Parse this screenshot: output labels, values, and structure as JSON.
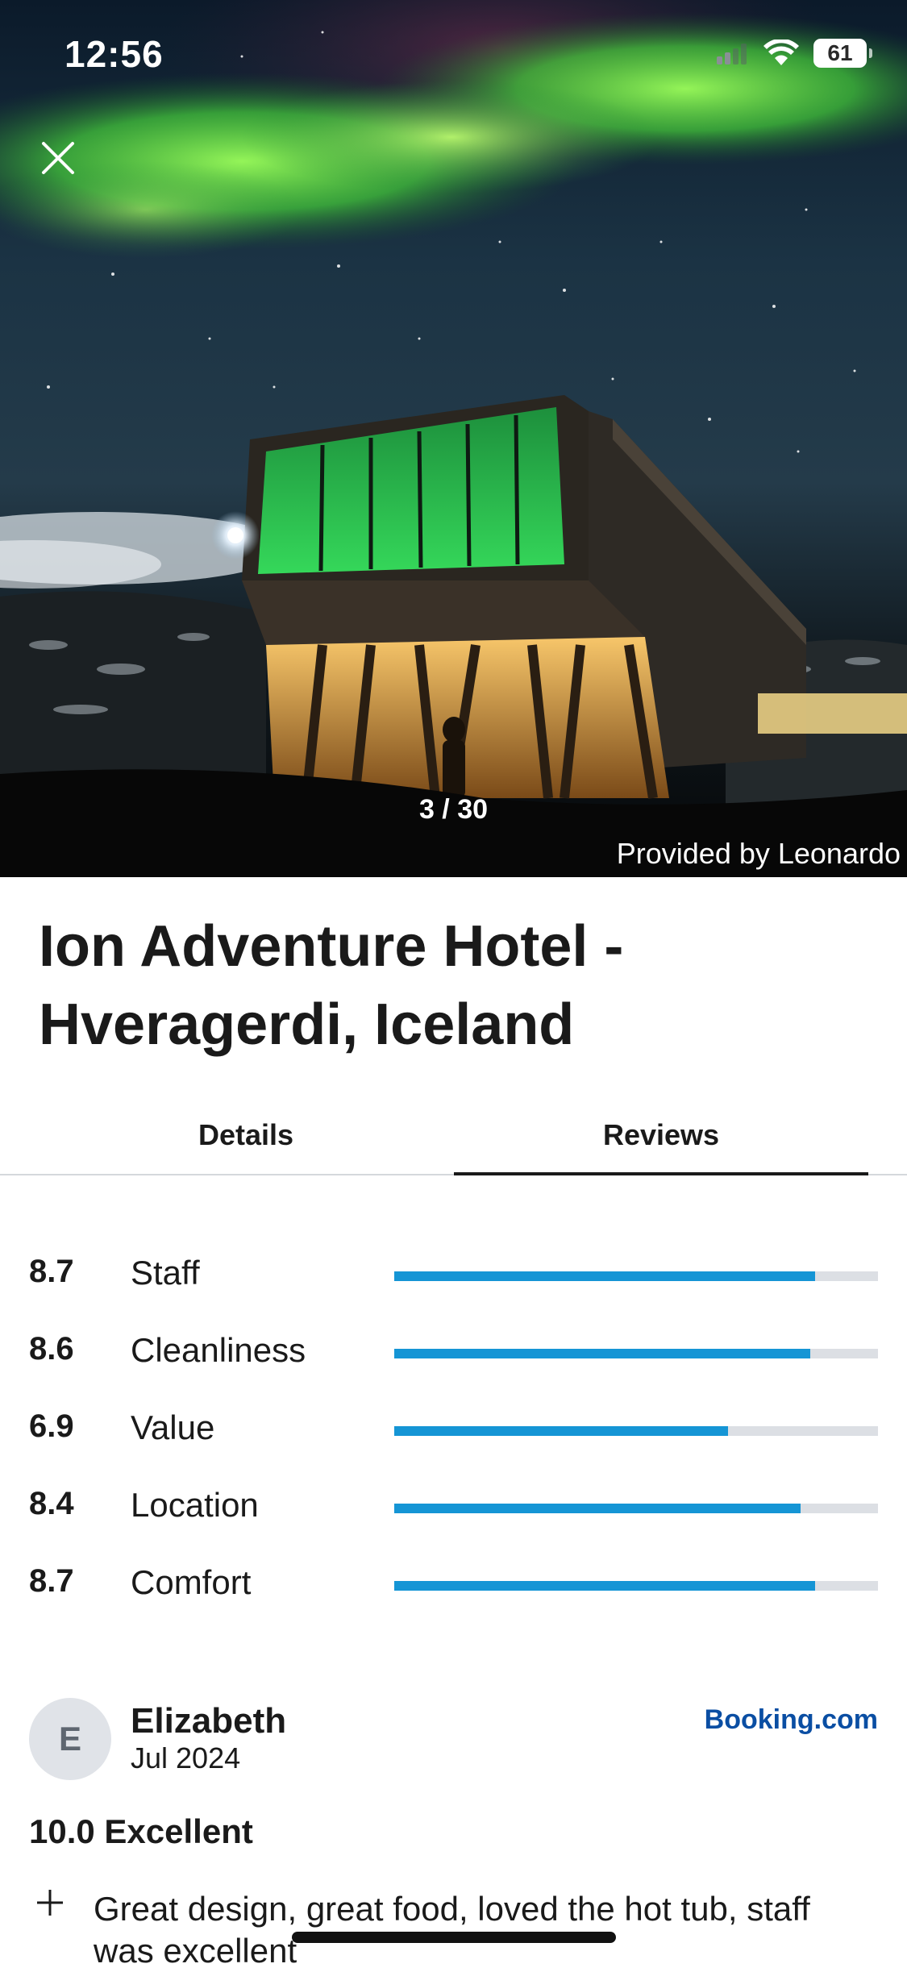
{
  "status_bar": {
    "time": "12:56",
    "battery": "61"
  },
  "gallery": {
    "counter": "3 / 30",
    "credit": "Provided by Leonardo"
  },
  "hotel": {
    "title": "Ion Adventure Hotel - Hveragerdi, Iceland"
  },
  "tabs": [
    {
      "label": "Details",
      "active": false
    },
    {
      "label": "Reviews",
      "active": true
    }
  ],
  "ratings": [
    {
      "score": "8.7",
      "label": "Staff",
      "fill": 0.87
    },
    {
      "score": "8.6",
      "label": "Cleanliness",
      "fill": 0.86
    },
    {
      "score": "6.9",
      "label": "Value",
      "fill": 0.69
    },
    {
      "score": "8.4",
      "label": "Location",
      "fill": 0.84
    },
    {
      "score": "8.7",
      "label": "Comfort",
      "fill": 0.87
    }
  ],
  "review": {
    "avatar_initial": "E",
    "reviewer": "Elizabeth",
    "date": "Jul 2024",
    "source": "Booking.com",
    "score_text": "10.0 Excellent",
    "text": "Great design, great food, loved the hot tub, staff was excellent"
  },
  "colors": {
    "rating_fill": "#1595d5",
    "rating_track": "#dcdfe4",
    "source_brand": "#0a4ea3"
  }
}
